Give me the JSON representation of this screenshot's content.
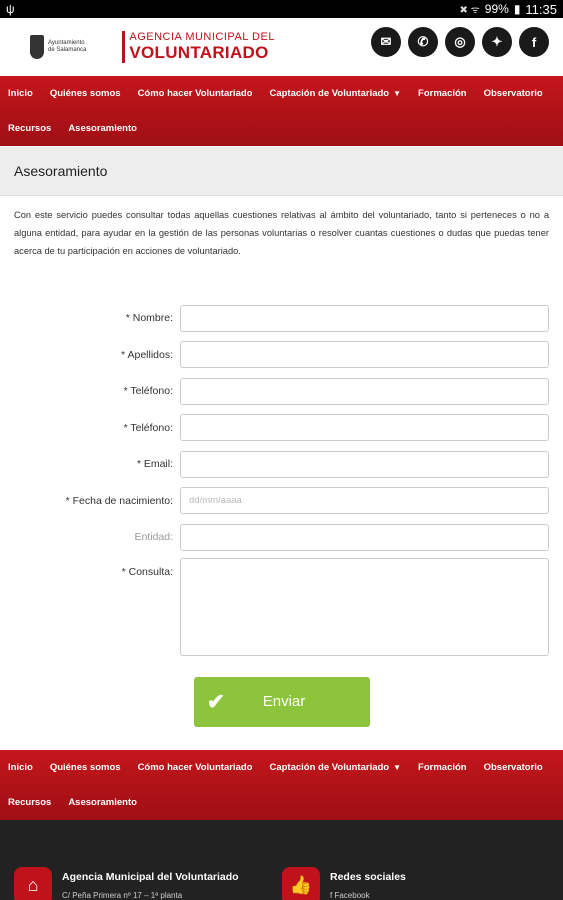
{
  "status": {
    "icons": "✖ ᯤ",
    "battery": "99%",
    "time": "11:35"
  },
  "header": {
    "ayto_line1": "Ayuntamiento",
    "ayto_line2": "de Salamanca",
    "agency_top": "Agencia Municipal del",
    "agency_main": "VOLUNTARIADO",
    "socials": [
      "email-icon",
      "phone-icon",
      "whatsapp-icon",
      "twitter-icon",
      "facebook-icon"
    ]
  },
  "nav": {
    "row1": [
      "Inicio",
      "Quiénes somos",
      "Cómo hacer Voluntariado",
      "Captación de Voluntariado",
      "Formación",
      "Observatorio"
    ],
    "row2": [
      "Recursos",
      "Asesoramiento"
    ]
  },
  "page": {
    "title": "Asesoramiento",
    "intro": "Con este servicio puedes consultar todas aquellas cuestiones relativas al ámbito del voluntariado, tanto si perteneces o no a alguna entidad, para ayudar en la gestión de las personas voluntarias o resolver cuantas cuestiones o dudas que puedas tener acerca de tu participación en acciones de voluntariado."
  },
  "form": {
    "nombre": "* Nombre:",
    "apellidos": "* Apellidos:",
    "telefono1": "* Teléfono:",
    "telefono2": "* Teléfono:",
    "email": "* Email:",
    "fecha": "* Fecha de nacimiento:",
    "fecha_placeholder": "dd/mm/aaaa",
    "entidad": "Entidad:",
    "consulta": "* Consulta:",
    "submit": "Enviar"
  },
  "footer": {
    "agency_title": "Agencia Municipal del Voluntariado",
    "agency_address": "C/ Peña Primera nº 17 – 1ª planta",
    "social_title": "Redes sociales",
    "social_first": "Facebook"
  }
}
